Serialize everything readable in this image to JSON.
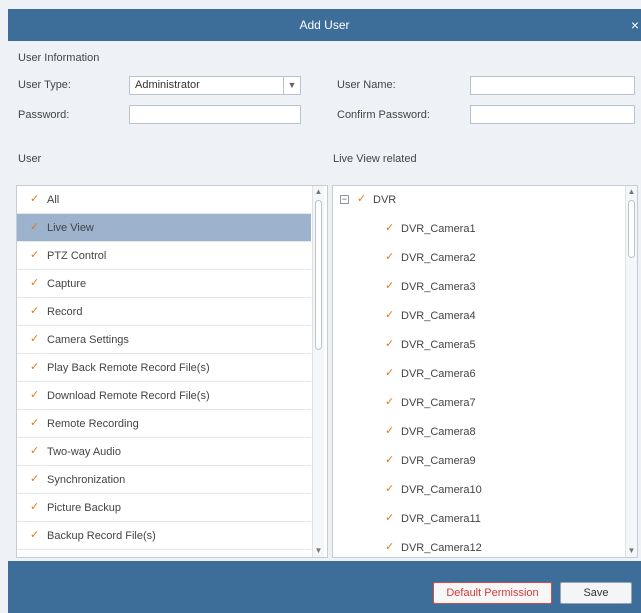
{
  "dialog": {
    "title": "Add User",
    "close_label": "×"
  },
  "user_info": {
    "section_label": "User Information",
    "user_type_label": "User Type:",
    "user_type_value": "Administrator",
    "user_name_label": "User Name:",
    "user_name_value": "",
    "password_label": "Password:",
    "password_value": "",
    "confirm_password_label": "Confirm Password:",
    "confirm_password_value": ""
  },
  "permissions": {
    "label": "User",
    "items": [
      {
        "label": "All",
        "checked": true
      },
      {
        "label": "Live View",
        "checked": true,
        "selected": true
      },
      {
        "label": "PTZ Control",
        "checked": true
      },
      {
        "label": "Capture",
        "checked": true
      },
      {
        "label": "Record",
        "checked": true
      },
      {
        "label": "Camera Settings",
        "checked": true
      },
      {
        "label": "Play Back Remote Record File(s)",
        "checked": true
      },
      {
        "label": "Download Remote Record File(s)",
        "checked": true
      },
      {
        "label": "Remote Recording",
        "checked": true
      },
      {
        "label": "Two-way Audio",
        "checked": true
      },
      {
        "label": "Synchronization",
        "checked": true
      },
      {
        "label": "Picture Backup",
        "checked": true
      },
      {
        "label": "Backup Record File(s)",
        "checked": true
      }
    ]
  },
  "related": {
    "label": "Live View related",
    "root": {
      "label": "DVR",
      "checked": true,
      "expanded": true,
      "toggle_symbol": "−"
    },
    "cameras": [
      {
        "label": "DVR_Camera1",
        "checked": true
      },
      {
        "label": "DVR_Camera2",
        "checked": true
      },
      {
        "label": "DVR_Camera3",
        "checked": true
      },
      {
        "label": "DVR_Camera4",
        "checked": true
      },
      {
        "label": "DVR_Camera5",
        "checked": true
      },
      {
        "label": "DVR_Camera6",
        "checked": true
      },
      {
        "label": "DVR_Camera7",
        "checked": true
      },
      {
        "label": "DVR_Camera8",
        "checked": true
      },
      {
        "label": "DVR_Camera9",
        "checked": true
      },
      {
        "label": "DVR_Camera10",
        "checked": true
      },
      {
        "label": "DVR_Camera11",
        "checked": true
      },
      {
        "label": "DVR_Camera12",
        "checked": true
      }
    ]
  },
  "buttons": {
    "default_permission": "Default Permission",
    "save": "Save"
  },
  "icons": {
    "checkbox": "checkmark-icon",
    "dropdown": "chevron-down-icon",
    "close": "close-icon",
    "scroll_up": "scroll-up-icon",
    "scroll_down": "scroll-down-icon",
    "tree_toggle": "tree-collapse-icon"
  },
  "colors": {
    "titlebar": "#3d6e9a",
    "selected_row": "#9db2cc",
    "checkbox": "#e07b1d",
    "default_button_text": "#d23b3b"
  }
}
